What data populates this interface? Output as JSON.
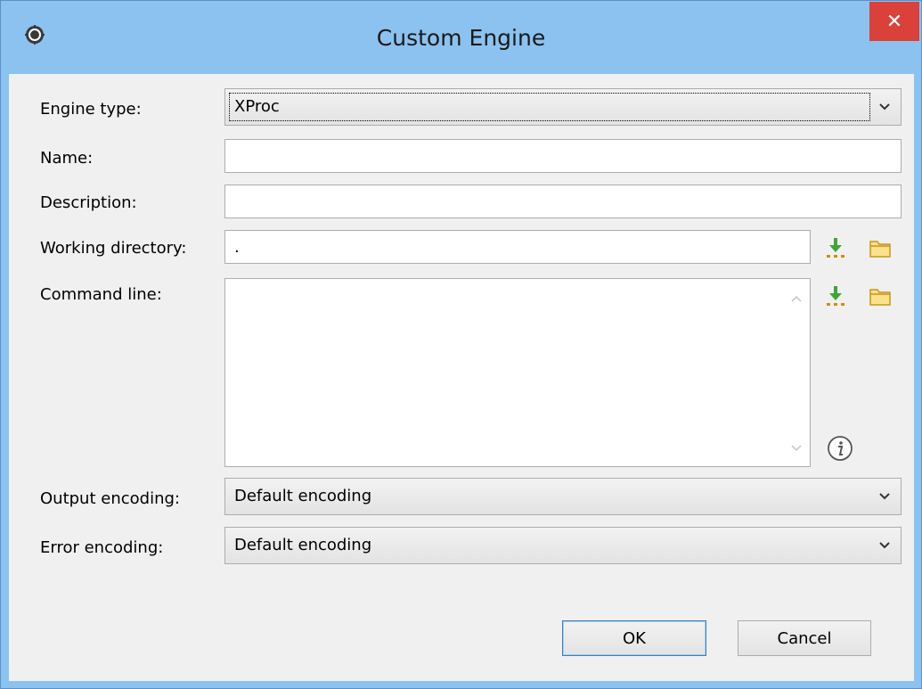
{
  "window": {
    "title": "Custom Engine",
    "close_label": "✕"
  },
  "form": {
    "engine_type": {
      "label": "Engine type:",
      "value": "XProc"
    },
    "name": {
      "label": "Name:",
      "value": ""
    },
    "description": {
      "label": "Description:",
      "value": ""
    },
    "working_directory": {
      "label": "Working directory:",
      "value": "."
    },
    "command_line": {
      "label": "Command line:",
      "value": ""
    },
    "output_encoding": {
      "label": "Output encoding:",
      "value": "Default encoding"
    },
    "error_encoding": {
      "label": "Error encoding:",
      "value": "Default encoding"
    }
  },
  "icons": {
    "insert": "insert-variable-icon",
    "browse": "folder-icon",
    "info": "info-icon",
    "app": "gear-icon"
  },
  "buttons": {
    "ok": "OK",
    "cancel": "Cancel"
  },
  "colors": {
    "titlebar": "#8cc2f0",
    "close": "#d9413a",
    "dialog_bg": "#f0f0f0",
    "default_button_border": "#3c7fb1"
  }
}
